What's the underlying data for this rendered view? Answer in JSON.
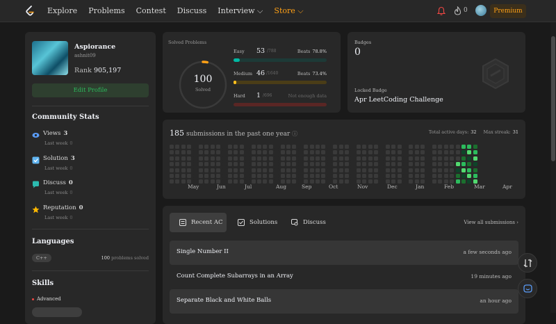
{
  "nav": {
    "links": [
      "Explore",
      "Problems",
      "Contest",
      "Discuss",
      "Interview ⌵",
      "Store ⌵"
    ],
    "fire_count": "0",
    "premium": "Premium"
  },
  "profile": {
    "name": "Aspiorance",
    "id": "ashnit09",
    "rank_label": "Rank",
    "rank": "905,197",
    "edit": "Edit Profile"
  },
  "community": {
    "title": "Community Stats",
    "items": [
      {
        "label": "Views",
        "value": "3",
        "sub": "Last week",
        "delta": "0",
        "color": "#5a9cf8",
        "icon": "eye-icon"
      },
      {
        "label": "Solution",
        "value": "3",
        "sub": "Last week",
        "delta": "0",
        "color": "#60b4f0",
        "icon": "solution-check-icon"
      },
      {
        "label": "Discuss",
        "value": "0",
        "sub": "Last week",
        "delta": "0",
        "color": "#2cbbb0",
        "icon": "discuss-bubble-icon"
      },
      {
        "label": "Reputation",
        "value": "0",
        "sub": "Last week",
        "delta": "0",
        "color": "#ffb800",
        "icon": "star-icon"
      }
    ]
  },
  "languages": {
    "title": "Languages",
    "name": "C++",
    "count": "100",
    "suffix": "problems solved"
  },
  "skills": {
    "title": "Skills",
    "level": "Advanced"
  },
  "solved": {
    "title": "Solved Problems",
    "total": "100",
    "total_label": "Solved",
    "progress_fraction": 0.03,
    "easy": {
      "label": "Easy",
      "count": "53",
      "total": "/788",
      "beats_label": "Beats",
      "beats": "78.8%",
      "fraction": 0.067,
      "color": "#00b8a3",
      "track": "#1d3a37"
    },
    "medium": {
      "label": "Medium",
      "count": "46",
      "total": "/1640",
      "beats_label": "Beats",
      "beats": "73.4%",
      "fraction": 0.028,
      "color": "#ffc01e",
      "track": "#4a3d17"
    },
    "hard": {
      "label": "Hard",
      "count": "1",
      "total": "/696",
      "note": "Not enough data",
      "fraction": 0.0,
      "color": "#ef4743",
      "track": "#5a2624"
    }
  },
  "badges": {
    "title": "Badges",
    "count": "0",
    "locked_label": "Locked Badge",
    "locked_name": "Apr LeetCoding Challenge"
  },
  "calendar": {
    "count": "185",
    "text": "submissions in the past one year",
    "active_label": "Total active days:",
    "active": "32",
    "streak_label": "Max streak:",
    "streak": "31",
    "months": [
      "May",
      "Jun",
      "Jul",
      "Aug",
      "Sep",
      "Oct",
      "Nov",
      "Dec",
      "Jan",
      "Feb",
      "Mar",
      "Apr"
    ]
  },
  "recent": {
    "tabs": [
      "Recent AC",
      "Solutions",
      "Discuss"
    ],
    "view_all": "View all submissions ›",
    "rows": [
      {
        "title": "Single Number II",
        "time": "a few seconds ago"
      },
      {
        "title": "Count Complete Subarrays in an Array",
        "time": "19 minutes ago"
      },
      {
        "title": "Separate Black and White Balls",
        "time": "an hour ago"
      }
    ]
  }
}
